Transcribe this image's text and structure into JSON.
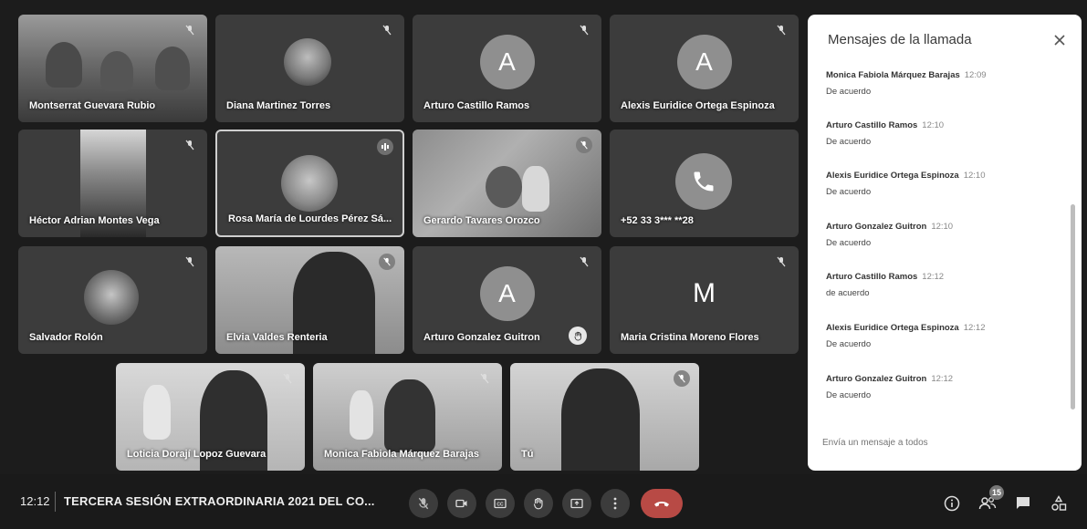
{
  "meeting": {
    "time": "12:12",
    "title": "TERCERA SESIÓN EXTRAORDINARIA 2021 DEL CO..."
  },
  "participants": [
    {
      "name": "Montserrat Guevara Rubio"
    },
    {
      "name": "Diana Martinez Torres"
    },
    {
      "name": "Arturo Castillo Ramos",
      "initial": "A"
    },
    {
      "name": "Alexis Euridice Ortega Espinoza",
      "initial": "A"
    },
    {
      "name": "Héctor Adrian Montes Vega"
    },
    {
      "name": "Rosa María de Lourdes Pérez Sá..."
    },
    {
      "name": "Gerardo Tavares Orozco"
    },
    {
      "name": "+52 33 3*** **28"
    },
    {
      "name": "Salvador Rolón"
    },
    {
      "name": "Elvia Valdes Renteria"
    },
    {
      "name": "Arturo Gonzalez Guitron",
      "initial": "A"
    },
    {
      "name": "Maria Cristina Moreno Flores",
      "initial": "M"
    },
    {
      "name": "Loticia Dorají Lopoz Guevara"
    },
    {
      "name": "Monica Fabiola Márquez Barajas"
    },
    {
      "name": "Tú"
    }
  ],
  "chat": {
    "title": "Mensajes de la llamada",
    "input_placeholder": "Envía un mensaje a todos",
    "messages": [
      {
        "sender": "Monica Fabiola Márquez Barajas",
        "time": "12:09",
        "text": "De acuerdo"
      },
      {
        "sender": "Arturo Castillo Ramos",
        "time": "12:10",
        "text": "De acuerdo"
      },
      {
        "sender": "Alexis Euridice Ortega Espinoza",
        "time": "12:10",
        "text": "De acuerdo"
      },
      {
        "sender": "Arturo Gonzalez Guitron",
        "time": "12:10",
        "text": "De acuerdo"
      },
      {
        "sender": "Arturo Castillo Ramos",
        "time": "12:12",
        "text": "de acuerdo"
      },
      {
        "sender": "Alexis Euridice Ortega Espinoza",
        "time": "12:12",
        "text": "De acuerdo"
      },
      {
        "sender": "Arturo Gonzalez Guitron",
        "time": "12:12",
        "text": "De acuerdo"
      }
    ]
  },
  "toolbar": {
    "people_count": "15",
    "buttons": [
      "mic-off-icon",
      "camera-icon",
      "captions-icon",
      "raise-hand-icon",
      "present-icon",
      "more-vert-icon",
      "end-call-icon"
    ],
    "end_call_color": "#b84a45"
  }
}
